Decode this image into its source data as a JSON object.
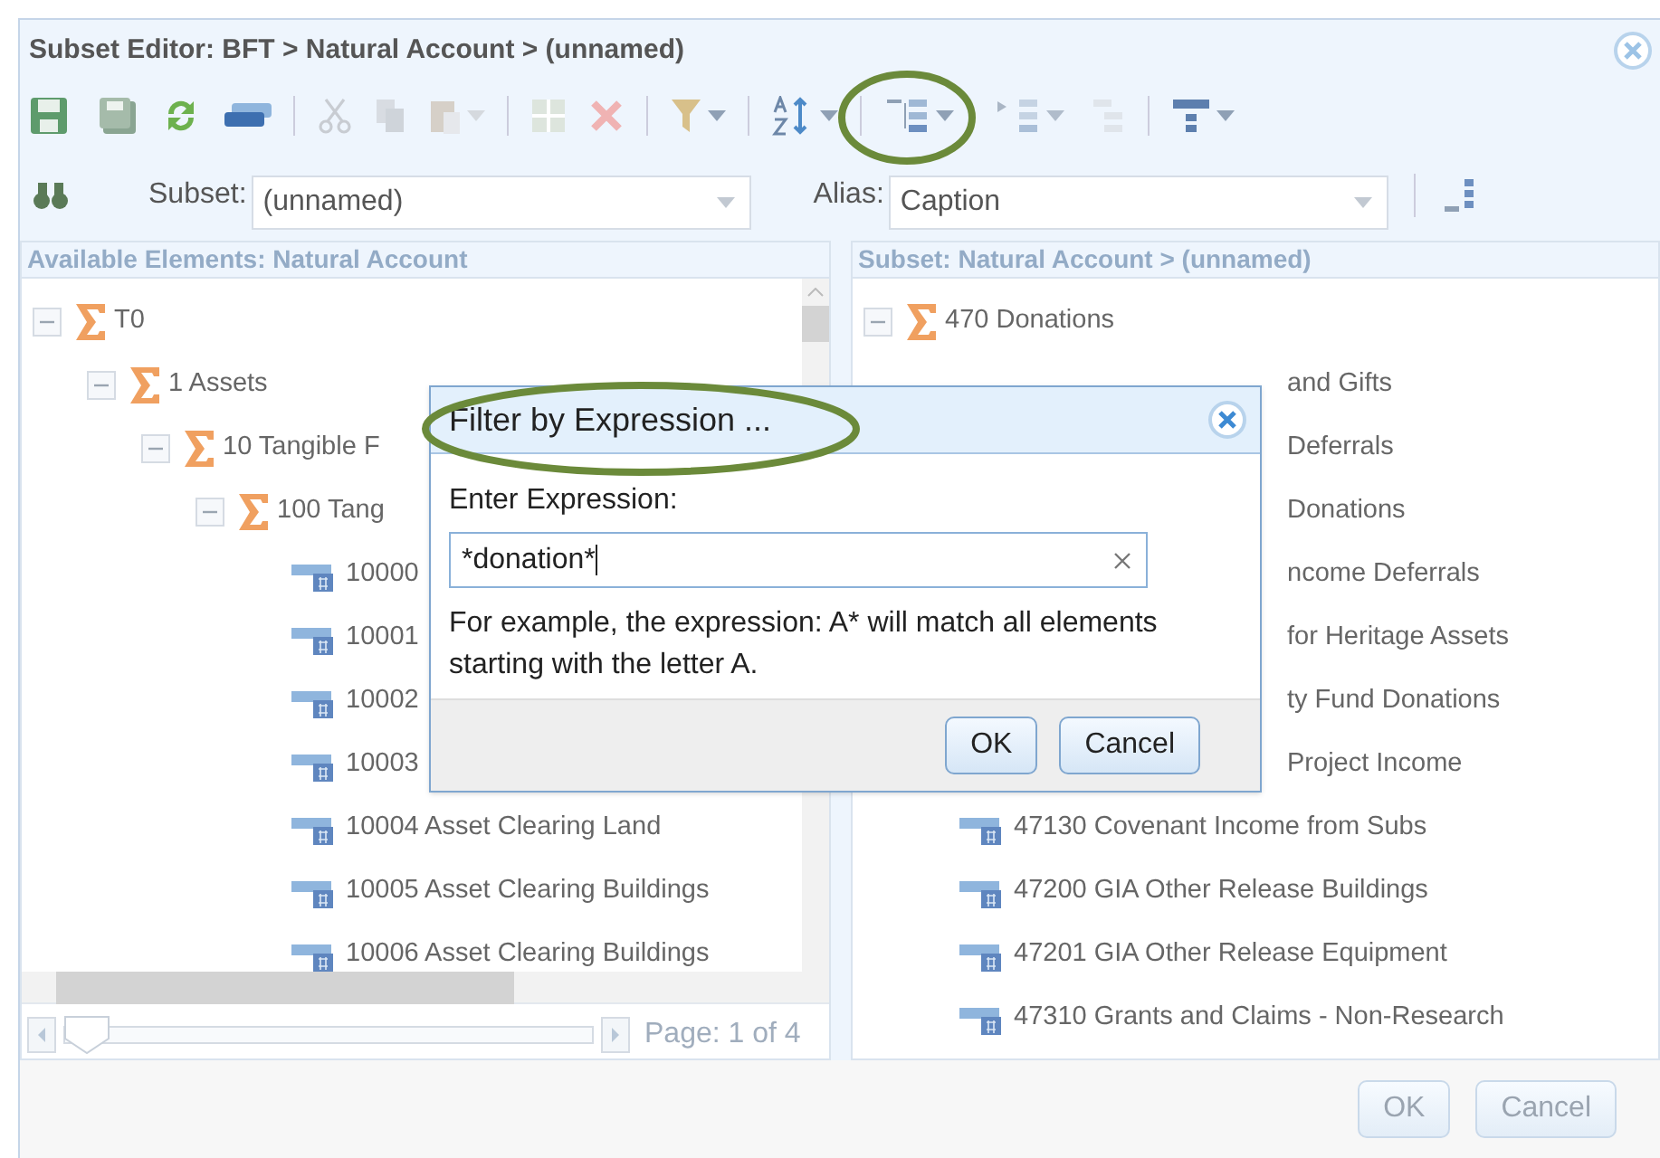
{
  "window": {
    "title": "Subset Editor: BFT > Natural Account > (unnamed)"
  },
  "subset": {
    "label": "Subset:",
    "value": "(unnamed)"
  },
  "alias": {
    "label": "Alias:",
    "value": "Caption"
  },
  "left_panel": {
    "header": "Available Elements: Natural Account",
    "page": "Page: 1 of 4",
    "page_slider": {
      "level": 0
    },
    "tree": [
      {
        "kind": "consolidated",
        "label": "T0",
        "expanded": true,
        "children": [
          {
            "kind": "consolidated",
            "label": "1 Assets",
            "expanded": true,
            "children": [
              {
                "kind": "consolidated",
                "label": "10 Tangible F",
                "expanded": true,
                "children": [
                  {
                    "kind": "consolidated",
                    "label": "100 Tang",
                    "expanded": true,
                    "children": [
                      {
                        "kind": "leaf",
                        "label": "10000"
                      },
                      {
                        "kind": "leaf",
                        "label": "10001"
                      },
                      {
                        "kind": "leaf",
                        "label": "10002"
                      },
                      {
                        "kind": "leaf",
                        "label": "10003"
                      },
                      {
                        "kind": "leaf",
                        "label": "10004 Asset Clearing Land"
                      },
                      {
                        "kind": "leaf",
                        "label": "10005 Asset Clearing Buildings"
                      },
                      {
                        "kind": "leaf",
                        "label": "10006 Asset Clearing Buildings"
                      }
                    ]
                  }
                ]
              }
            ]
          }
        ]
      }
    ]
  },
  "right_panel": {
    "header": "Subset: Natural Account > (unnamed)",
    "tree": [
      {
        "kind": "consolidated",
        "label": "470 Donations",
        "expanded": true,
        "children": [
          {
            "kind": "partial",
            "label": "and Gifts"
          },
          {
            "kind": "partial",
            "label": "Deferrals"
          },
          {
            "kind": "partial",
            "label": "Donations"
          },
          {
            "kind": "partial",
            "label": "ncome Deferrals"
          },
          {
            "kind": "partial",
            "label": "for Heritage Assets"
          },
          {
            "kind": "partial",
            "label": "ty Fund Donations"
          },
          {
            "kind": "partial",
            "label": "Project Income"
          },
          {
            "kind": "leaf",
            "label": "47130 Covenant Income from Subs"
          },
          {
            "kind": "leaf",
            "label": "47200 GIA Other Release Buildings"
          },
          {
            "kind": "leaf",
            "label": "47201 GIA Other Release Equipment"
          },
          {
            "kind": "leaf",
            "label": "47310 Grants and Claims - Non-Research"
          }
        ]
      }
    ]
  },
  "dialog": {
    "title": "Filter by Expression ...",
    "label": "Enter Expression:",
    "value": "*donation*",
    "hint": "For example, the expression: A* will match all elements starting with the letter A.",
    "buttons": [
      "OK",
      "Cancel"
    ]
  },
  "footer": {
    "buttons": [
      "OK",
      "Cancel"
    ]
  }
}
